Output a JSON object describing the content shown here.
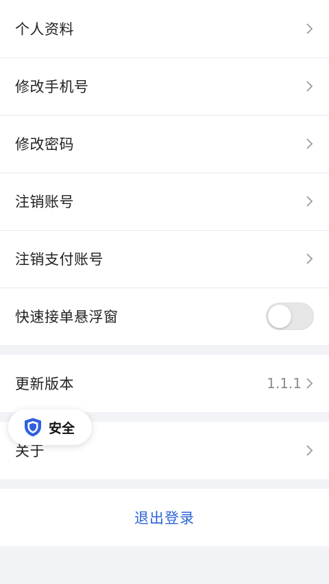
{
  "settings": {
    "items": [
      {
        "label": "个人资料"
      },
      {
        "label": "修改手机号"
      },
      {
        "label": "修改密码"
      },
      {
        "label": "注销账号"
      },
      {
        "label": "注销支付账号"
      }
    ],
    "float_window": {
      "label": "快速接单悬浮窗",
      "enabled": false
    }
  },
  "version": {
    "label": "更新版本",
    "value": "1.1.1"
  },
  "about": {
    "label": "关于"
  },
  "logout": {
    "label": "退出登录"
  },
  "security_badge": {
    "label": "安全",
    "icon": "shield-icon"
  },
  "colors": {
    "accent": "#2b63d9",
    "shield": "#2f5fe0",
    "background": "#f2f3f7"
  }
}
